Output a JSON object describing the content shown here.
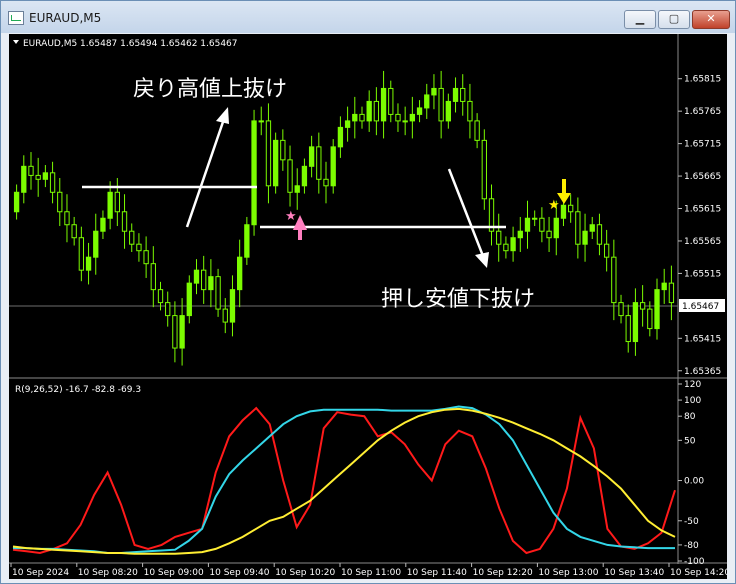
{
  "window": {
    "title": "EURAUD,M5"
  },
  "symbol_info": "EURAUD,M5  1.65487 1.65494 1.65462 1.65467",
  "indicator_info": "R(9,26,52) -16.7 -82.8 -69.3",
  "current_price": "1.65467",
  "annotations": {
    "breakout_up": "戻り高値上抜け",
    "breakout_down": "押し安値下抜け"
  },
  "colors": {
    "background": "#000000",
    "candle": "#7cfc00",
    "fast_line": "#ff1a1a",
    "mid_line": "#33d6e8",
    "slow_line": "#ffee33",
    "marker_up": "#ff7fbf",
    "marker_down": "#ffee00"
  },
  "icons": {
    "minimize": "minimize-icon",
    "maximize": "maximize-icon",
    "close": "close-icon"
  },
  "chart_data": [
    {
      "type": "candlestick",
      "title": "EURAUD,M5",
      "ylim": [
        1.6536,
        1.6585
      ],
      "price_ticks": [
        "1.65815",
        "1.65765",
        "1.65715",
        "1.65665",
        "1.65615",
        "1.65565",
        "1.65515",
        "1.65415",
        "1.65365"
      ],
      "close": [
        1.6564,
        1.6568,
        1.65666,
        1.6566,
        1.6567,
        1.6564,
        1.6561,
        1.6559,
        1.6557,
        1.6552,
        1.6554,
        1.6558,
        1.656,
        1.6564,
        1.6561,
        1.6558,
        1.6556,
        1.6555,
        1.6553,
        1.6549,
        1.6547,
        1.6545,
        1.654,
        1.6545,
        1.655,
        1.6552,
        1.6549,
        1.6551,
        1.6546,
        1.6544,
        1.6549,
        1.6554,
        1.6559,
        1.6575,
        1.6575,
        1.6565,
        1.6572,
        1.6569,
        1.6564,
        1.6565,
        1.6568,
        1.6571,
        1.6566,
        1.6565,
        1.6571,
        1.6574,
        1.6575,
        1.6576,
        1.6575,
        1.6578,
        1.6575,
        1.658,
        1.6576,
        1.6575,
        1.6575,
        1.6576,
        1.6577,
        1.6579,
        1.658,
        1.6575,
        1.6578,
        1.658,
        1.6578,
        1.6575,
        1.6572,
        1.6563,
        1.6558,
        1.6556,
        1.6555,
        1.6557,
        1.6558,
        1.656,
        1.656,
        1.6558,
        1.6557,
        1.656,
        1.6562,
        1.6561,
        1.6556,
        1.6558,
        1.6559,
        1.6556,
        1.6554,
        1.6547,
        1.6545,
        1.6541,
        1.6547,
        1.6546,
        1.6543,
        1.6549,
        1.655,
        1.6547
      ],
      "current_price": 1.65467
    },
    {
      "type": "line",
      "title": "R(9,26,52) -16.7 -82.8 -69.3",
      "ylim": [
        -100,
        120
      ],
      "y_ticks": [
        "120",
        "100",
        "80",
        "50",
        "0.00",
        "-50",
        "-80",
        "-100"
      ],
      "x_tick_labels": [
        "10 Sep 2024",
        "10 Sep 08:20",
        "10 Sep 09:00",
        "10 Sep 09:40",
        "10 Sep 10:20",
        "10 Sep 11:00",
        "10 Sep 11:40",
        "10 Sep 12:20",
        "10 Sep 13:00",
        "10 Sep 13:40",
        "10 Sep 14:20"
      ],
      "series": [
        {
          "color": "#ff1a1a",
          "values": [
            -86,
            -88,
            -90,
            -85,
            -78,
            -55,
            -18,
            10,
            -30,
            -80,
            -85,
            -80,
            -70,
            -65,
            -60,
            10,
            55,
            75,
            90,
            70,
            0,
            -58,
            -30,
            65,
            85,
            82,
            80,
            55,
            60,
            45,
            20,
            0,
            45,
            62,
            55,
            15,
            -35,
            -75,
            -90,
            -85,
            -60,
            -10,
            78,
            40,
            -60,
            -82,
            -85,
            -78,
            -65,
            -12
          ]
        },
        {
          "color": "#33d6e8",
          "values": [
            -84,
            -84,
            -85,
            -85,
            -86,
            -87,
            -88,
            -90,
            -90,
            -89,
            -88,
            -87,
            -86,
            -75,
            -60,
            -20,
            8,
            25,
            40,
            55,
            70,
            80,
            86,
            88,
            88,
            88,
            88,
            88,
            87,
            87,
            87,
            87,
            89,
            92,
            90,
            82,
            70,
            50,
            20,
            -10,
            -40,
            -60,
            -70,
            -75,
            -80,
            -82,
            -83,
            -84,
            -84,
            -84
          ]
        },
        {
          "color": "#ffee33",
          "values": [
            -82,
            -84,
            -85,
            -86,
            -87,
            -88,
            -89,
            -90,
            -90,
            -91,
            -91,
            -91,
            -91,
            -90,
            -89,
            -85,
            -78,
            -70,
            -60,
            -50,
            -45,
            -35,
            -25,
            -10,
            5,
            20,
            35,
            50,
            62,
            72,
            80,
            85,
            88,
            89,
            87,
            83,
            78,
            72,
            65,
            58,
            50,
            40,
            30,
            18,
            5,
            -10,
            -30,
            -50,
            -62,
            -70
          ]
        }
      ]
    }
  ]
}
